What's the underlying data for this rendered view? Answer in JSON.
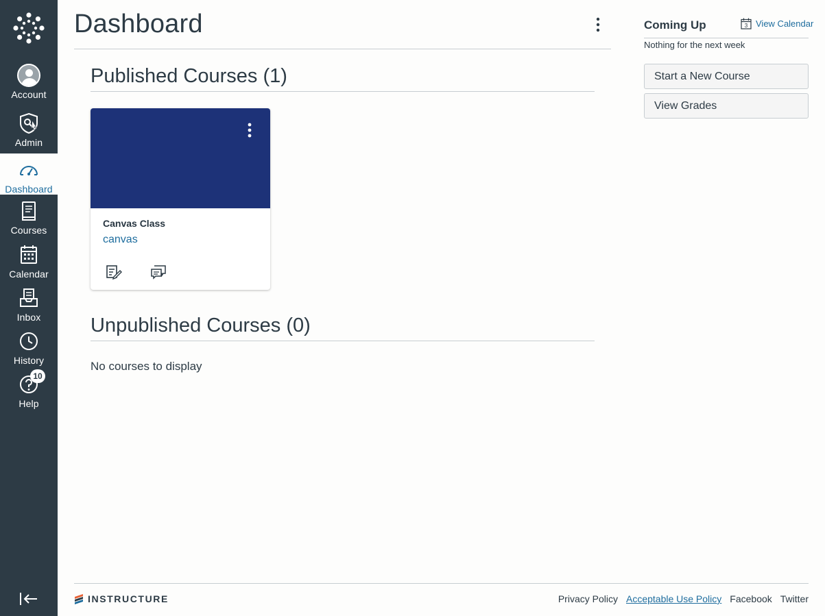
{
  "nav": {
    "items": [
      {
        "key": "account",
        "label": "Account"
      },
      {
        "key": "admin",
        "label": "Admin"
      },
      {
        "key": "dashboard",
        "label": "Dashboard"
      },
      {
        "key": "courses",
        "label": "Courses"
      },
      {
        "key": "calendar",
        "label": "Calendar"
      },
      {
        "key": "inbox",
        "label": "Inbox"
      },
      {
        "key": "history",
        "label": "History"
      },
      {
        "key": "help",
        "label": "Help",
        "badge": "10"
      }
    ],
    "active": "dashboard"
  },
  "header": {
    "title": "Dashboard"
  },
  "published": {
    "title": "Published Courses (1)",
    "courses": [
      {
        "name": "Canvas Class",
        "code": "canvas",
        "color": "#1d3278"
      }
    ]
  },
  "unpublished": {
    "title": "Unpublished Courses (0)",
    "empty_text": "No courses to display"
  },
  "sidebar": {
    "coming_up_title": "Coming Up",
    "view_calendar": "View Calendar",
    "calendar_icon_day": "3",
    "nothing_text": "Nothing for the next week",
    "start_course": "Start a New Course",
    "view_grades": "View Grades"
  },
  "footer": {
    "brand": "INSTRUCTURE",
    "links": [
      "Privacy Policy",
      "Acceptable Use Policy",
      "Facebook",
      "Twitter"
    ]
  },
  "colors": {
    "nav_bg": "#2d3b45",
    "accent": "#1e6d9e",
    "card_hero": "#1d3278"
  }
}
